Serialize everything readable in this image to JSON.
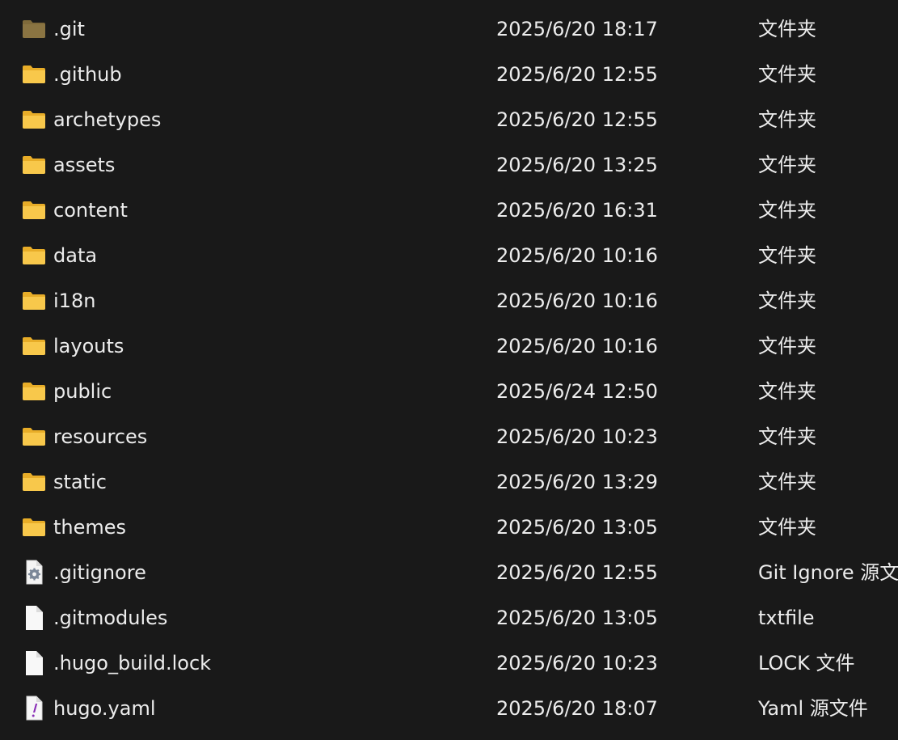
{
  "files": [
    {
      "name": ".git",
      "date": "2025/6/20 18:17",
      "type": "文件夹",
      "icon": "hidden-folder-icon",
      "hidden": true
    },
    {
      "name": ".github",
      "date": "2025/6/20 12:55",
      "type": "文件夹",
      "icon": "folder-icon"
    },
    {
      "name": "archetypes",
      "date": "2025/6/20 12:55",
      "type": "文件夹",
      "icon": "folder-icon"
    },
    {
      "name": "assets",
      "date": "2025/6/20 13:25",
      "type": "文件夹",
      "icon": "folder-icon"
    },
    {
      "name": "content",
      "date": "2025/6/20 16:31",
      "type": "文件夹",
      "icon": "folder-icon"
    },
    {
      "name": "data",
      "date": "2025/6/20 10:16",
      "type": "文件夹",
      "icon": "folder-icon"
    },
    {
      "name": "i18n",
      "date": "2025/6/20 10:16",
      "type": "文件夹",
      "icon": "folder-icon"
    },
    {
      "name": "layouts",
      "date": "2025/6/20 10:16",
      "type": "文件夹",
      "icon": "folder-icon"
    },
    {
      "name": "public",
      "date": "2025/6/24 12:50",
      "type": "文件夹",
      "icon": "folder-icon"
    },
    {
      "name": "resources",
      "date": "2025/6/20 10:23",
      "type": "文件夹",
      "icon": "folder-icon"
    },
    {
      "name": "static",
      "date": "2025/6/20 13:29",
      "type": "文件夹",
      "icon": "folder-icon"
    },
    {
      "name": "themes",
      "date": "2025/6/20 13:05",
      "type": "文件夹",
      "icon": "folder-icon"
    },
    {
      "name": ".gitignore",
      "date": "2025/6/20 12:55",
      "type": "Git Ignore 源文件",
      "icon": "settings-file-icon"
    },
    {
      "name": ".gitmodules",
      "date": "2025/6/20 13:05",
      "type": "txtfile",
      "icon": "file-icon"
    },
    {
      "name": ".hugo_build.lock",
      "date": "2025/6/20 10:23",
      "type": "LOCK 文件",
      "icon": "file-icon"
    },
    {
      "name": "hugo.yaml",
      "date": "2025/6/20 18:07",
      "type": "Yaml 源文件",
      "icon": "yaml-file-icon"
    }
  ],
  "colors": {
    "background": "#191919",
    "text": "#ececec",
    "folder": "#f6c342",
    "hidden_folder": "#7f6a3a"
  }
}
